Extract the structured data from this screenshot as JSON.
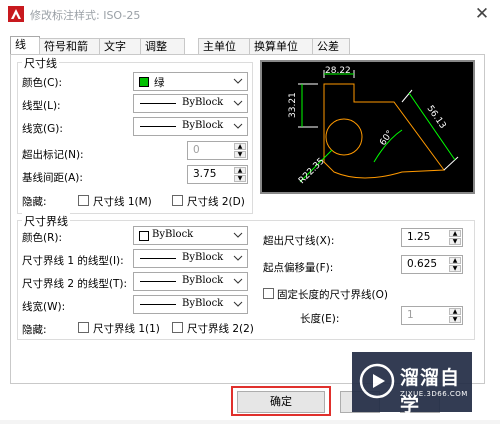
{
  "window": {
    "title": "修改标注样式: ISO-25",
    "close_glyph": "✕"
  },
  "tabs": [
    {
      "label": "线",
      "active": true
    },
    {
      "label": "符号和箭头"
    },
    {
      "label": "文字"
    },
    {
      "label": "调整"
    },
    {
      "label": "主单位"
    },
    {
      "label": "换算单位"
    },
    {
      "label": "公差"
    }
  ],
  "dim_lines": {
    "title": "尺寸线",
    "color_label": "颜色(C):",
    "color_value": "绿",
    "color_swatch": "#00c000",
    "linetype_label": "线型(L):",
    "linetype_value": "ByBlock",
    "lineweight_label": "线宽(G):",
    "lineweight_value": "ByBlock",
    "extend_ticks_label": "超出标记(N):",
    "extend_ticks_value": "0",
    "baseline_spacing_label": "基线间距(A):",
    "baseline_spacing_value": "3.75",
    "suppress_label": "隐藏:",
    "suppress_1": "尺寸线 1(M)",
    "suppress_2": "尺寸线 2(D)"
  },
  "ext_lines": {
    "title": "尺寸界线",
    "color_label": "颜色(R):",
    "color_value": "ByBlock",
    "linetype1_label": "尺寸界线 1 的线型(I):",
    "linetype1_value": "ByBlock",
    "linetype2_label": "尺寸界线 2 的线型(T):",
    "linetype2_value": "ByBlock",
    "lineweight_label": "线宽(W):",
    "lineweight_value": "ByBlock",
    "suppress_label": "隐藏:",
    "suppress_1": "尺寸界线 1(1)",
    "suppress_2": "尺寸界线 2(2)",
    "extend_beyond_label": "超出尺寸线(X):",
    "extend_beyond_value": "1.25",
    "offset_label": "起点偏移量(F):",
    "offset_value": "0.625",
    "fixed_length_label": "固定长度的尺寸界线(O)",
    "length_label": "长度(E):",
    "length_value": "1"
  },
  "preview": {
    "dim_top": "28.22",
    "dim_left": "33.21",
    "dim_right": "56.13",
    "dim_angle": "60°",
    "dim_radius": "R22.35"
  },
  "buttons": {
    "ok": "确定"
  },
  "watermark": {
    "text": "溜溜自学",
    "sub": "ZIXUE.3D66.COM"
  }
}
